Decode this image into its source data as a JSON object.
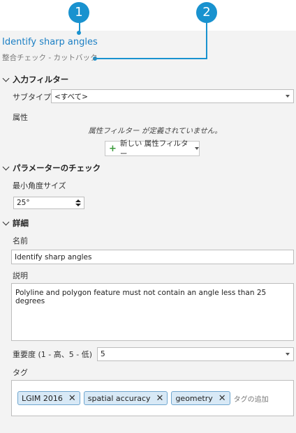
{
  "callouts": [
    "1",
    "2"
  ],
  "header": {
    "title": "Identify sharp angles",
    "subtitle": "整合チェック - カットバック"
  },
  "input_filter": {
    "heading": "入力フィルター",
    "subtype_label": "サブタイプ",
    "subtype_value": "<すべて>",
    "attribute_label": "属性",
    "attribute_note": "属性フィルター が定義されていません。",
    "new_filter_button": "新しい 属性フィルター"
  },
  "parameters": {
    "heading": "パラメーターのチェック",
    "min_angle_label": "最小角度サイズ",
    "min_angle_value": "25°"
  },
  "details": {
    "heading": "詳細",
    "name_label": "名前",
    "name_value": "Identify sharp angles",
    "description_label": "説明",
    "description_value": "Polyline and polygon feature must not contain an angle less than 25 degrees",
    "severity_label": "重要度 (1 - 高、5 - 低)",
    "severity_value": "5",
    "tags_label": "タグ",
    "tags": [
      "LGIM 2016",
      "spatial accuracy",
      "geometry"
    ],
    "tag_placeholder": "タグの追加"
  },
  "colors": {
    "accent": "#1992cf",
    "title": "#1b7fc4",
    "panel": "#f3f3f3",
    "chip": "#d8e9f6"
  }
}
